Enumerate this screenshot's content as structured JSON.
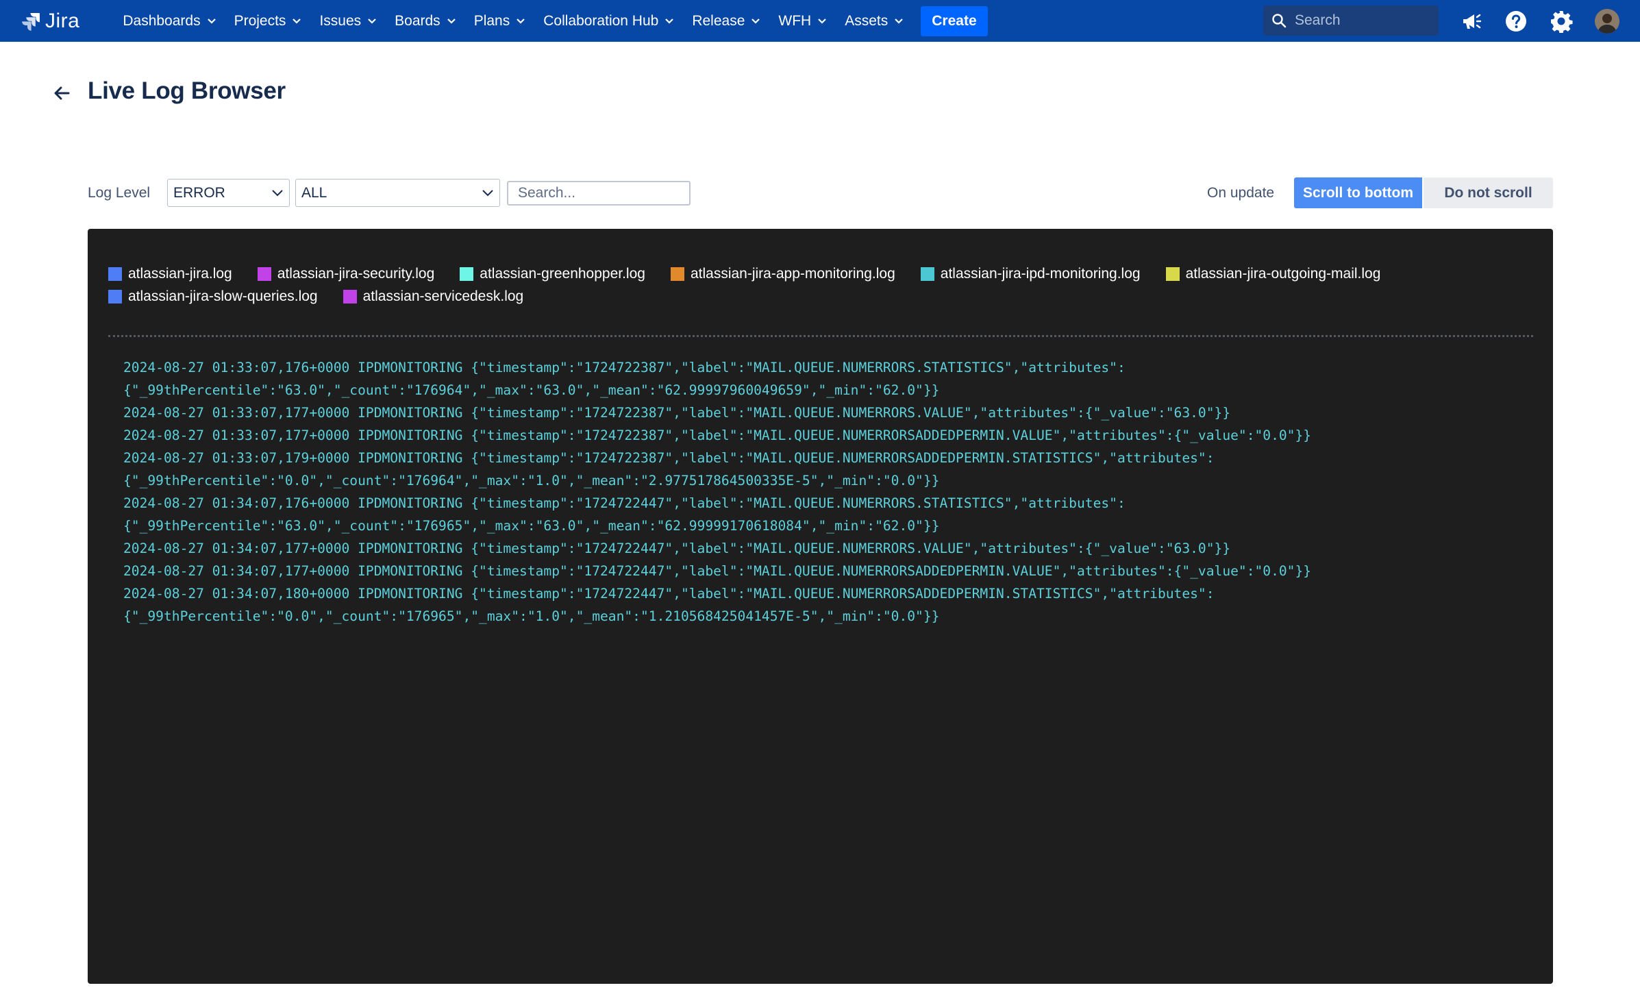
{
  "app": {
    "logo_text": "Jira",
    "colors": {
      "nav_bg": "#0747a6",
      "create_bg": "#0065ff",
      "primary_btn": "#4c8cf5",
      "log_bg": "#1e1e1e",
      "log_text": "#5cd0db"
    }
  },
  "nav": {
    "items": [
      {
        "label": "Dashboards"
      },
      {
        "label": "Projects"
      },
      {
        "label": "Issues"
      },
      {
        "label": "Boards"
      },
      {
        "label": "Plans"
      },
      {
        "label": "Collaboration Hub"
      },
      {
        "label": "Release"
      },
      {
        "label": "WFH"
      },
      {
        "label": "Assets"
      }
    ],
    "create_label": "Create",
    "search_placeholder": "Search",
    "icons": [
      "search-icon",
      "megaphone-icon",
      "help-icon",
      "gear-icon",
      "avatar"
    ]
  },
  "page": {
    "title": "Live Log Browser"
  },
  "toolbar": {
    "log_level_label": "Log Level",
    "level_select_value": "ERROR",
    "source_select_value": "ALL",
    "search_placeholder": "Search...",
    "on_update_label": "On update",
    "scroll_bottom_label": "Scroll to bottom",
    "no_scroll_label": "Do not scroll"
  },
  "legend": {
    "row1": [
      {
        "name": "atlassian-jira.log",
        "color": "#4f7df5"
      },
      {
        "name": "atlassian-jira-security.log",
        "color": "#c142e6"
      },
      {
        "name": "atlassian-greenhopper.log",
        "color": "#6ff5e6"
      },
      {
        "name": "atlassian-jira-app-monitoring.log",
        "color": "#e08a2c"
      },
      {
        "name": "atlassian-jira-ipd-monitoring.log",
        "color": "#4cc8d4"
      },
      {
        "name": "atlassian-jira-outgoing-mail.log",
        "color": "#d8d94a"
      }
    ],
    "row2": [
      {
        "name": "atlassian-jira-slow-queries.log",
        "color": "#4f7df5"
      },
      {
        "name": "atlassian-servicedesk.log",
        "color": "#c142e6"
      }
    ]
  },
  "log_lines": [
    "2024-08-27 01:33:07,176+0000 IPDMONITORING {\"timestamp\":\"1724722387\",\"label\":\"MAIL.QUEUE.NUMERRORS.STATISTICS\",\"attributes\":",
    "{\"_99thPercentile\":\"63.0\",\"_count\":\"176964\",\"_max\":\"63.0\",\"_mean\":\"62.99997960049659\",\"_min\":\"62.0\"}}",
    "2024-08-27 01:33:07,177+0000 IPDMONITORING {\"timestamp\":\"1724722387\",\"label\":\"MAIL.QUEUE.NUMERRORS.VALUE\",\"attributes\":{\"_value\":\"63.0\"}}",
    "2024-08-27 01:33:07,177+0000 IPDMONITORING {\"timestamp\":\"1724722387\",\"label\":\"MAIL.QUEUE.NUMERRORSADDEDPERMIN.VALUE\",\"attributes\":{\"_value\":\"0.0\"}}",
    "2024-08-27 01:33:07,179+0000 IPDMONITORING {\"timestamp\":\"1724722387\",\"label\":\"MAIL.QUEUE.NUMERRORSADDEDPERMIN.STATISTICS\",\"attributes\":",
    "{\"_99thPercentile\":\"0.0\",\"_count\":\"176964\",\"_max\":\"1.0\",\"_mean\":\"2.977517864500335E-5\",\"_min\":\"0.0\"}}",
    "2024-08-27 01:34:07,176+0000 IPDMONITORING {\"timestamp\":\"1724722447\",\"label\":\"MAIL.QUEUE.NUMERRORS.STATISTICS\",\"attributes\":",
    "{\"_99thPercentile\":\"63.0\",\"_count\":\"176965\",\"_max\":\"63.0\",\"_mean\":\"62.99999170618084\",\"_min\":\"62.0\"}}",
    "2024-08-27 01:34:07,177+0000 IPDMONITORING {\"timestamp\":\"1724722447\",\"label\":\"MAIL.QUEUE.NUMERRORS.VALUE\",\"attributes\":{\"_value\":\"63.0\"}}",
    "2024-08-27 01:34:07,177+0000 IPDMONITORING {\"timestamp\":\"1724722447\",\"label\":\"MAIL.QUEUE.NUMERRORSADDEDPERMIN.VALUE\",\"attributes\":{\"_value\":\"0.0\"}}",
    "2024-08-27 01:34:07,180+0000 IPDMONITORING {\"timestamp\":\"1724722447\",\"label\":\"MAIL.QUEUE.NUMERRORSADDEDPERMIN.STATISTICS\",\"attributes\":",
    "{\"_99thPercentile\":\"0.0\",\"_count\":\"176965\",\"_max\":\"1.0\",\"_mean\":\"1.210568425041457E-5\",\"_min\":\"0.0\"}}"
  ]
}
